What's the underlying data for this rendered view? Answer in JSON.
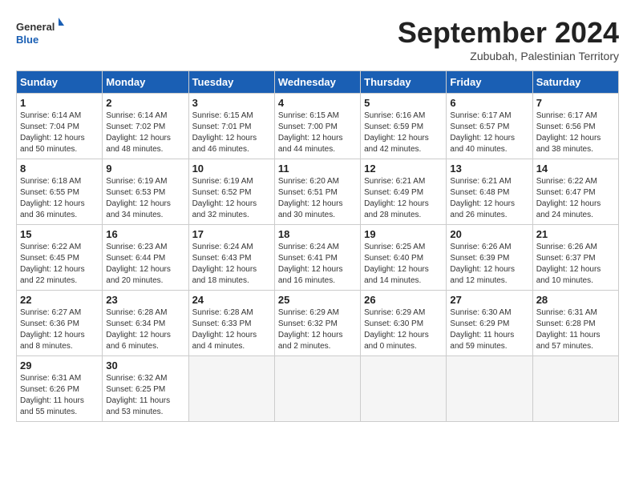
{
  "header": {
    "logo_general": "General",
    "logo_blue": "Blue",
    "month": "September 2024",
    "location": "Zububah, Palestinian Territory"
  },
  "days_of_week": [
    "Sunday",
    "Monday",
    "Tuesday",
    "Wednesday",
    "Thursday",
    "Friday",
    "Saturday"
  ],
  "weeks": [
    [
      {
        "day": "1",
        "info": "Sunrise: 6:14 AM\nSunset: 7:04 PM\nDaylight: 12 hours\nand 50 minutes."
      },
      {
        "day": "2",
        "info": "Sunrise: 6:14 AM\nSunset: 7:02 PM\nDaylight: 12 hours\nand 48 minutes."
      },
      {
        "day": "3",
        "info": "Sunrise: 6:15 AM\nSunset: 7:01 PM\nDaylight: 12 hours\nand 46 minutes."
      },
      {
        "day": "4",
        "info": "Sunrise: 6:15 AM\nSunset: 7:00 PM\nDaylight: 12 hours\nand 44 minutes."
      },
      {
        "day": "5",
        "info": "Sunrise: 6:16 AM\nSunset: 6:59 PM\nDaylight: 12 hours\nand 42 minutes."
      },
      {
        "day": "6",
        "info": "Sunrise: 6:17 AM\nSunset: 6:57 PM\nDaylight: 12 hours\nand 40 minutes."
      },
      {
        "day": "7",
        "info": "Sunrise: 6:17 AM\nSunset: 6:56 PM\nDaylight: 12 hours\nand 38 minutes."
      }
    ],
    [
      {
        "day": "8",
        "info": "Sunrise: 6:18 AM\nSunset: 6:55 PM\nDaylight: 12 hours\nand 36 minutes."
      },
      {
        "day": "9",
        "info": "Sunrise: 6:19 AM\nSunset: 6:53 PM\nDaylight: 12 hours\nand 34 minutes."
      },
      {
        "day": "10",
        "info": "Sunrise: 6:19 AM\nSunset: 6:52 PM\nDaylight: 12 hours\nand 32 minutes."
      },
      {
        "day": "11",
        "info": "Sunrise: 6:20 AM\nSunset: 6:51 PM\nDaylight: 12 hours\nand 30 minutes."
      },
      {
        "day": "12",
        "info": "Sunrise: 6:21 AM\nSunset: 6:49 PM\nDaylight: 12 hours\nand 28 minutes."
      },
      {
        "day": "13",
        "info": "Sunrise: 6:21 AM\nSunset: 6:48 PM\nDaylight: 12 hours\nand 26 minutes."
      },
      {
        "day": "14",
        "info": "Sunrise: 6:22 AM\nSunset: 6:47 PM\nDaylight: 12 hours\nand 24 minutes."
      }
    ],
    [
      {
        "day": "15",
        "info": "Sunrise: 6:22 AM\nSunset: 6:45 PM\nDaylight: 12 hours\nand 22 minutes."
      },
      {
        "day": "16",
        "info": "Sunrise: 6:23 AM\nSunset: 6:44 PM\nDaylight: 12 hours\nand 20 minutes."
      },
      {
        "day": "17",
        "info": "Sunrise: 6:24 AM\nSunset: 6:43 PM\nDaylight: 12 hours\nand 18 minutes."
      },
      {
        "day": "18",
        "info": "Sunrise: 6:24 AM\nSunset: 6:41 PM\nDaylight: 12 hours\nand 16 minutes."
      },
      {
        "day": "19",
        "info": "Sunrise: 6:25 AM\nSunset: 6:40 PM\nDaylight: 12 hours\nand 14 minutes."
      },
      {
        "day": "20",
        "info": "Sunrise: 6:26 AM\nSunset: 6:39 PM\nDaylight: 12 hours\nand 12 minutes."
      },
      {
        "day": "21",
        "info": "Sunrise: 6:26 AM\nSunset: 6:37 PM\nDaylight: 12 hours\nand 10 minutes."
      }
    ],
    [
      {
        "day": "22",
        "info": "Sunrise: 6:27 AM\nSunset: 6:36 PM\nDaylight: 12 hours\nand 8 minutes."
      },
      {
        "day": "23",
        "info": "Sunrise: 6:28 AM\nSunset: 6:34 PM\nDaylight: 12 hours\nand 6 minutes."
      },
      {
        "day": "24",
        "info": "Sunrise: 6:28 AM\nSunset: 6:33 PM\nDaylight: 12 hours\nand 4 minutes."
      },
      {
        "day": "25",
        "info": "Sunrise: 6:29 AM\nSunset: 6:32 PM\nDaylight: 12 hours\nand 2 minutes."
      },
      {
        "day": "26",
        "info": "Sunrise: 6:29 AM\nSunset: 6:30 PM\nDaylight: 12 hours\nand 0 minutes."
      },
      {
        "day": "27",
        "info": "Sunrise: 6:30 AM\nSunset: 6:29 PM\nDaylight: 11 hours\nand 59 minutes."
      },
      {
        "day": "28",
        "info": "Sunrise: 6:31 AM\nSunset: 6:28 PM\nDaylight: 11 hours\nand 57 minutes."
      }
    ],
    [
      {
        "day": "29",
        "info": "Sunrise: 6:31 AM\nSunset: 6:26 PM\nDaylight: 11 hours\nand 55 minutes."
      },
      {
        "day": "30",
        "info": "Sunrise: 6:32 AM\nSunset: 6:25 PM\nDaylight: 11 hours\nand 53 minutes."
      },
      {
        "day": "",
        "info": ""
      },
      {
        "day": "",
        "info": ""
      },
      {
        "day": "",
        "info": ""
      },
      {
        "day": "",
        "info": ""
      },
      {
        "day": "",
        "info": ""
      }
    ]
  ]
}
